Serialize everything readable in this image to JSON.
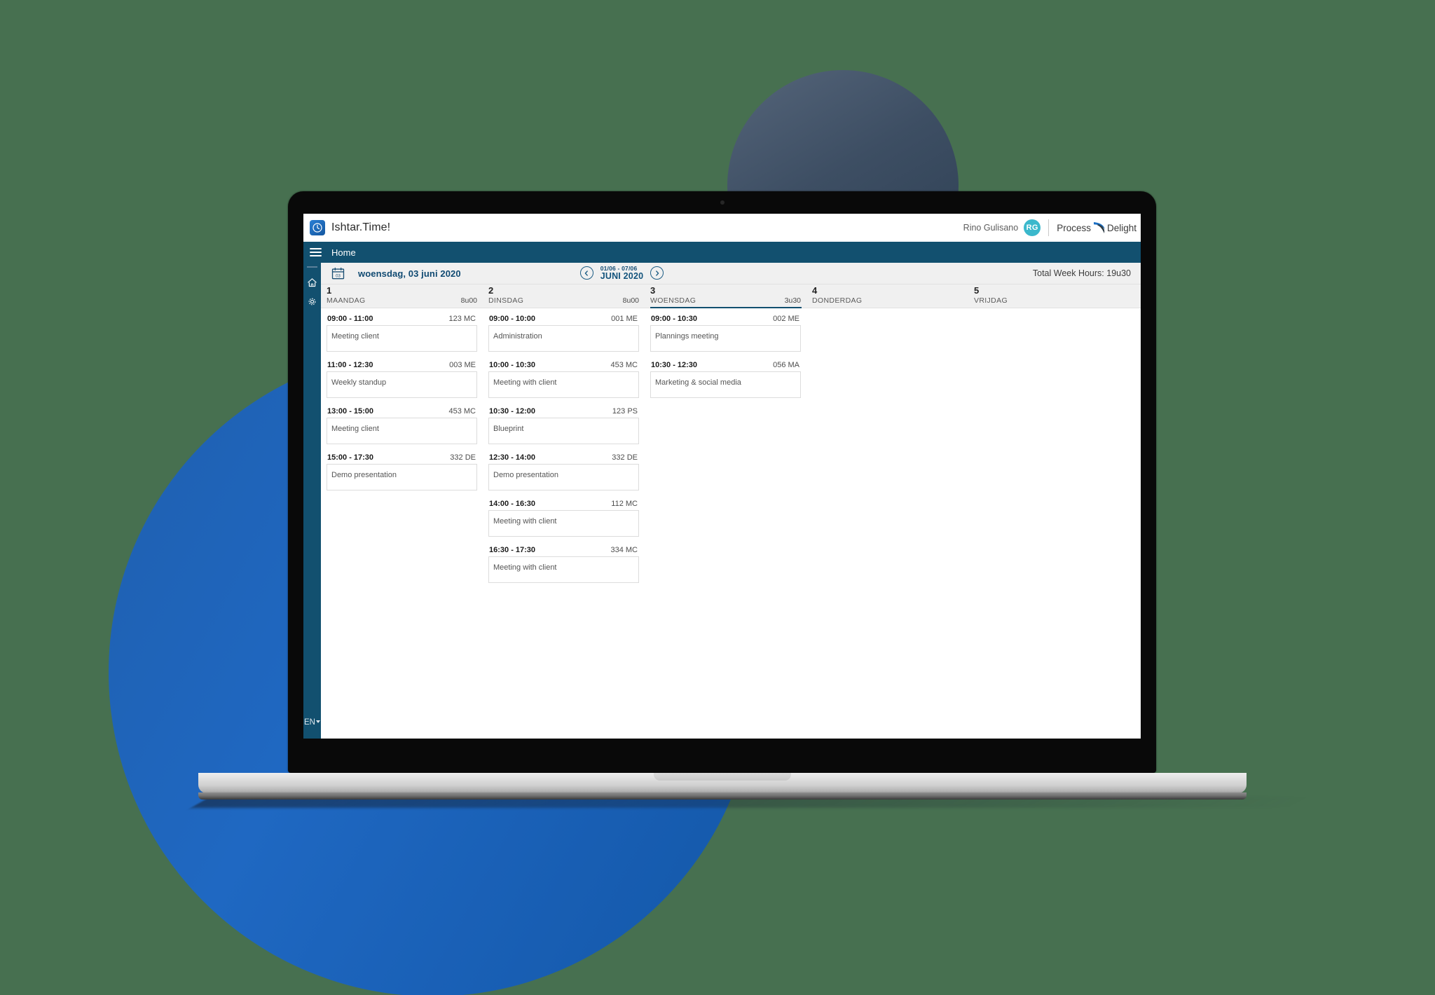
{
  "app": {
    "logo_icon": "clock-icon",
    "title": "Ishtar.Time!",
    "user_name": "Rino Gulisano",
    "user_initials": "RG",
    "brand_first": "Process",
    "brand_second": "Delight",
    "accent_color": "#12506f",
    "avatar_color": "#3bb8cc"
  },
  "nav": {
    "menu_icon": "hamburger-icon",
    "home_label": "Home"
  },
  "sidebar": {
    "items": [
      {
        "icon": "home-icon",
        "name": "sidebar-item-home"
      },
      {
        "icon": "gear-icon",
        "name": "sidebar-item-settings"
      }
    ],
    "language": "EN"
  },
  "toolbar": {
    "calendar_icon": "calendar-icon",
    "calendar_day": "03",
    "current_date": "woensdag, 03 juni 2020",
    "prev_icon": "chevron-left-icon",
    "next_icon": "chevron-right-icon",
    "week_range": "01/06 - 07/06",
    "week_month": "JUNI 2020",
    "total_hours_label": "Total Week Hours: 19u30"
  },
  "calendar": {
    "days": [
      {
        "number": "1",
        "name": "MAANDAG",
        "hours": "8u00",
        "active": false,
        "appointments": [
          {
            "time": "09:00 - 11:00",
            "code": "123 MC",
            "title": "Meeting client"
          },
          {
            "time": "11:00 - 12:30",
            "code": "003 ME",
            "title": "Weekly standup"
          },
          {
            "time": "13:00 - 15:00",
            "code": "453 MC",
            "title": "Meeting client"
          },
          {
            "time": "15:00 - 17:30",
            "code": "332 DE",
            "title": "Demo presentation"
          }
        ]
      },
      {
        "number": "2",
        "name": "DINSDAG",
        "hours": "8u00",
        "active": false,
        "appointments": [
          {
            "time": "09:00 - 10:00",
            "code": "001 ME",
            "title": "Administration"
          },
          {
            "time": "10:00 - 10:30",
            "code": "453 MC",
            "title": "Meeting with client"
          },
          {
            "time": "10:30 - 12:00",
            "code": "123 PS",
            "title": "Blueprint"
          },
          {
            "time": "12:30 - 14:00",
            "code": "332 DE",
            "title": "Demo presentation"
          },
          {
            "time": "14:00 - 16:30",
            "code": "112 MC",
            "title": "Meeting with client"
          },
          {
            "time": "16:30 - 17:30",
            "code": "334 MC",
            "title": "Meeting with client"
          }
        ]
      },
      {
        "number": "3",
        "name": "WOENSDAG",
        "hours": "3u30",
        "active": true,
        "appointments": [
          {
            "time": "09:00 - 10:30",
            "code": "002 ME",
            "title": "Plannings meeting"
          },
          {
            "time": "10:30 - 12:30",
            "code": "056 MA",
            "title": "Marketing & social media"
          }
        ]
      },
      {
        "number": "4",
        "name": "DONDERDAG",
        "hours": "",
        "active": false,
        "appointments": []
      },
      {
        "number": "5",
        "name": "VRIJDAG",
        "hours": "",
        "active": false,
        "appointments": []
      }
    ]
  }
}
